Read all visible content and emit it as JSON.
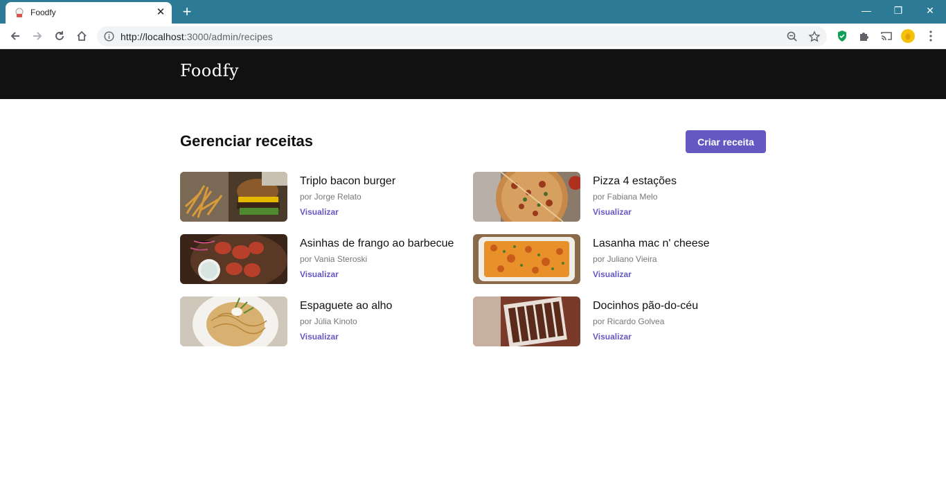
{
  "browser": {
    "tab_title": "Foodfy",
    "url_host": "http://localhost",
    "url_path": ":3000/admin/recipes",
    "window_controls": [
      "minimize-icon",
      "restore-icon",
      "close-icon"
    ]
  },
  "site": {
    "logo": "Foodfy"
  },
  "main": {
    "title": "Gerenciar receitas",
    "create_button": "Criar receita"
  },
  "recipes": [
    {
      "title": "Triplo bacon burger",
      "author": "por Jorge Relato",
      "link": "Visualizar"
    },
    {
      "title": "Pizza 4 estações",
      "author": "por Fabiana Melo",
      "link": "Visualizar"
    },
    {
      "title": "Asinhas de frango ao barbecue",
      "author": "por Vania Steroski",
      "link": "Visualizar"
    },
    {
      "title": "Lasanha mac n' cheese",
      "author": "por Juliano Vieira",
      "link": "Visualizar"
    },
    {
      "title": "Espaguete ao alho",
      "author": "por Júlia Kinoto",
      "link": "Visualizar"
    },
    {
      "title": "Docinhos pão-do-céu",
      "author": "por Ricardo Golvea",
      "link": "Visualizar"
    }
  ],
  "colors": {
    "tabbar": "#2c7a96",
    "header": "#111111",
    "accent": "#6558c3"
  }
}
